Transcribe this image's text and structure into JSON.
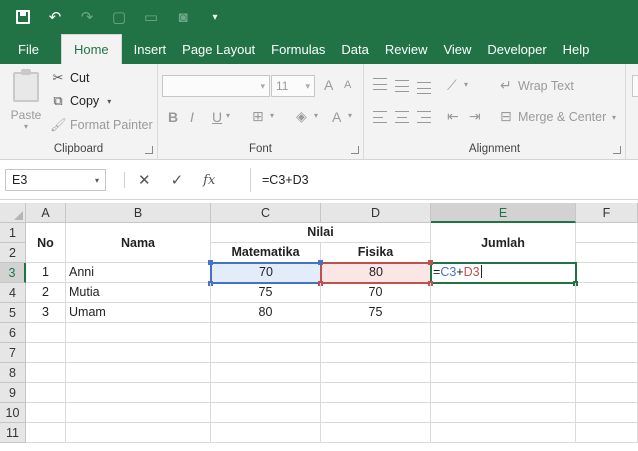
{
  "quick_access": {
    "icons": [
      "save-icon",
      "undo-icon",
      "redo-icon",
      "new-icon",
      "open-icon",
      "camera-icon",
      "customize-icon"
    ]
  },
  "tabs": [
    "File",
    "Home",
    "Insert",
    "Page Layout",
    "Formulas",
    "Data",
    "Review",
    "View",
    "Developer",
    "Help"
  ],
  "ribbon": {
    "clipboard": {
      "paste_label": "Paste",
      "cut_label": "Cut",
      "copy_label": "Copy",
      "format_painter_label": "Format Painter",
      "group_label": "Clipboard"
    },
    "font": {
      "size_value": "11",
      "grow_label": "A",
      "shrink_label": "A",
      "bold_label": "B",
      "italic_label": "I",
      "underline_label": "U",
      "font_color_label": "A",
      "group_label": "Font"
    },
    "alignment": {
      "wrap_text_label": "Wrap Text",
      "merge_center_label": "Merge & Center",
      "group_label": "Alignment"
    }
  },
  "formula_bar": {
    "name_box": "E3",
    "cancel_symbol": "✕",
    "enter_symbol": "✓",
    "fx_label": "fx",
    "formula": "=C3+D3"
  },
  "columns": [
    "A",
    "B",
    "C",
    "D",
    "E",
    "F"
  ],
  "rows": [
    "1",
    "2",
    "3",
    "4",
    "5",
    "6",
    "7",
    "8",
    "9",
    "10",
    "11"
  ],
  "sheet": {
    "header_no": "No",
    "header_nama": "Nama",
    "header_nilai": "Nilai",
    "header_matematika": "Matematika",
    "header_fisika": "Fisika",
    "header_jumlah": "Jumlah",
    "data": [
      {
        "no": "1",
        "nama": "Anni",
        "mat": "70",
        "fis": "80"
      },
      {
        "no": "2",
        "nama": "Mutia",
        "mat": "75",
        "fis": "70"
      },
      {
        "no": "3",
        "nama": "Umam",
        "mat": "80",
        "fis": "75"
      }
    ],
    "edit_cell": {
      "eq": "=",
      "ref1": "C3",
      "plus": "+",
      "ref2": "D3"
    }
  },
  "colors": {
    "excel_green": "#217346",
    "ref_blue": "#4472c4",
    "ref_red": "#c0504d"
  }
}
